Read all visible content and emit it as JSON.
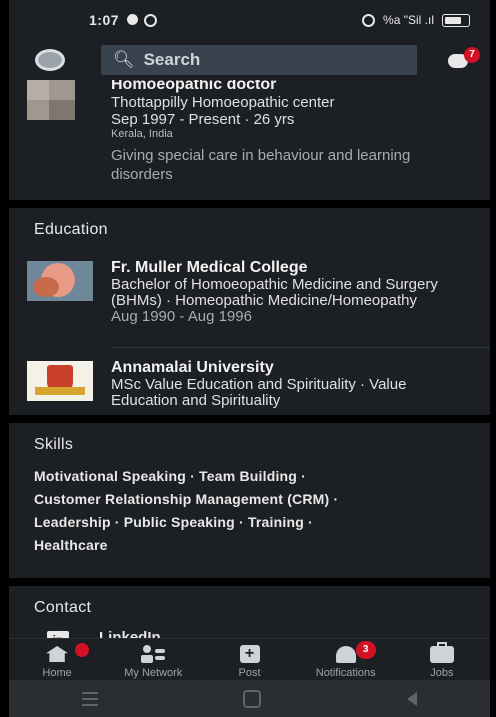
{
  "status": {
    "time": "1:07",
    "right_text": "%a \"Sil .ıl"
  },
  "header": {
    "search_placeholder": "Search",
    "message_badge": "7"
  },
  "experience": {
    "title": "Homoeopathic doctor",
    "company": "Thottappilly Homoeopathic center",
    "dates": "Sep 1997 - Present · 26 yrs",
    "location": "Kerala, India",
    "description": "Giving special care in behaviour and learning disorders"
  },
  "education": {
    "heading": "Education",
    "schools": [
      {
        "name": "Fr. Muller Medical College",
        "degree": "Bachelor of Homoeopathic Medicine and Surgery (BHMs) · Homeopathic Medicine/Homeopathy",
        "dates": "Aug 1990 - Aug 1996"
      },
      {
        "name": "Annamalai University",
        "degree": "MSc Value Education and Spirituality · Value Education and Spirituality"
      }
    ]
  },
  "skills": {
    "heading": "Skills",
    "lines": [
      "Motivational Speaking · Team Building ·",
      "Customer Relationship Management (CRM) ·",
      "Leadership · Public Speaking · Training ·",
      "Healthcare"
    ]
  },
  "contact": {
    "heading": "Contact",
    "icon_text": "in",
    "linkedin_label": "LinkedIn"
  },
  "nav": {
    "items": [
      {
        "label": "Home",
        "icon": "home-icon"
      },
      {
        "label": "My Network",
        "icon": "network-icon"
      },
      {
        "label": "Post",
        "icon": "post-icon"
      },
      {
        "label": "Notifications",
        "icon": "bell-icon",
        "badge": "3"
      },
      {
        "label": "Jobs",
        "icon": "briefcase-icon"
      }
    ]
  }
}
